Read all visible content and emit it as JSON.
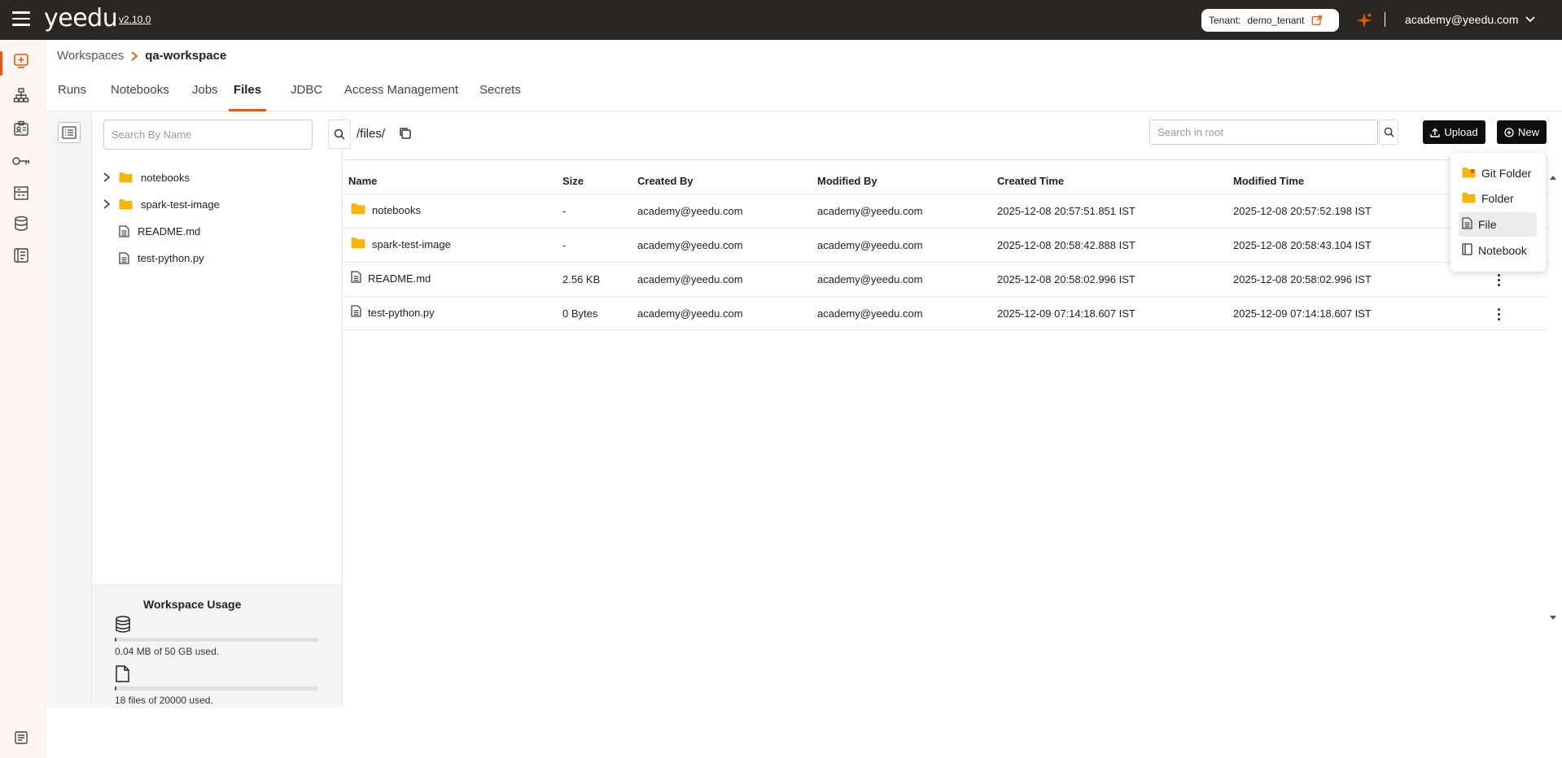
{
  "app": {
    "logo": "yeedu",
    "version": "v2.10.0"
  },
  "topbar": {
    "tenant_label": "Tenant:",
    "tenant_value": "demo_tenant",
    "user": "academy@yeedu.com"
  },
  "breadcrumb": {
    "parent": "Workspaces",
    "current": "qa-workspace"
  },
  "tabs": [
    "Runs",
    "Notebooks",
    "Jobs",
    "Files",
    "JDBC",
    "Access Management",
    "Secrets"
  ],
  "active_tab": "Files",
  "tree": {
    "search_placeholder": "Search By Name",
    "items": [
      {
        "name": "notebooks",
        "type": "folder"
      },
      {
        "name": "spark-test-image",
        "type": "folder"
      },
      {
        "name": "README.md",
        "type": "file"
      },
      {
        "name": "test-python.py",
        "type": "file"
      }
    ]
  },
  "usage": {
    "title": "Workspace Usage",
    "storage_text": "0.04 MB of 50 GB used.",
    "storage_fraction": 0.0008,
    "files_text": "18 files of 20000 used.",
    "files_fraction": 0.0009
  },
  "files": {
    "path": "/files/",
    "search_placeholder": "Search in root",
    "upload_label": "Upload",
    "new_label": "New",
    "columns": [
      "Name",
      "Size",
      "Created By",
      "Modified By",
      "Created Time",
      "Modified Time"
    ],
    "rows": [
      {
        "name": "notebooks",
        "type": "folder",
        "size": "-",
        "created_by": "academy@yeedu.com",
        "modified_by": "academy@yeedu.com",
        "created_time": "2025-12-08 20:57:51.851 IST",
        "modified_time": "2025-12-08 20:57:52.198 IST"
      },
      {
        "name": "spark-test-image",
        "type": "folder",
        "size": "-",
        "created_by": "academy@yeedu.com",
        "modified_by": "academy@yeedu.com",
        "created_time": "2025-12-08 20:58:42.888 IST",
        "modified_time": "2025-12-08 20:58:43.104 IST"
      },
      {
        "name": "README.md",
        "type": "file",
        "size": "2.56 KB",
        "created_by": "academy@yeedu.com",
        "modified_by": "academy@yeedu.com",
        "created_time": "2025-12-08 20:58:02.996 IST",
        "modified_time": "2025-12-08 20:58:02.996 IST"
      },
      {
        "name": "test-python.py",
        "type": "file",
        "size": "0 Bytes",
        "created_by": "academy@yeedu.com",
        "modified_by": "academy@yeedu.com",
        "created_time": "2025-12-09 07:14:18.607 IST",
        "modified_time": "2025-12-09 07:14:18.607 IST"
      }
    ]
  },
  "new_menu": {
    "items": [
      {
        "label": "Git Folder",
        "icon": "git-folder-icon"
      },
      {
        "label": "Folder",
        "icon": "folder-icon"
      },
      {
        "label": "File",
        "icon": "file-icon"
      },
      {
        "label": "Notebook",
        "icon": "notebook-icon"
      }
    ],
    "highlighted": "File"
  },
  "colors": {
    "accent": "#ea580c",
    "topbar": "#2b2622",
    "folder": "#f5b50a"
  }
}
